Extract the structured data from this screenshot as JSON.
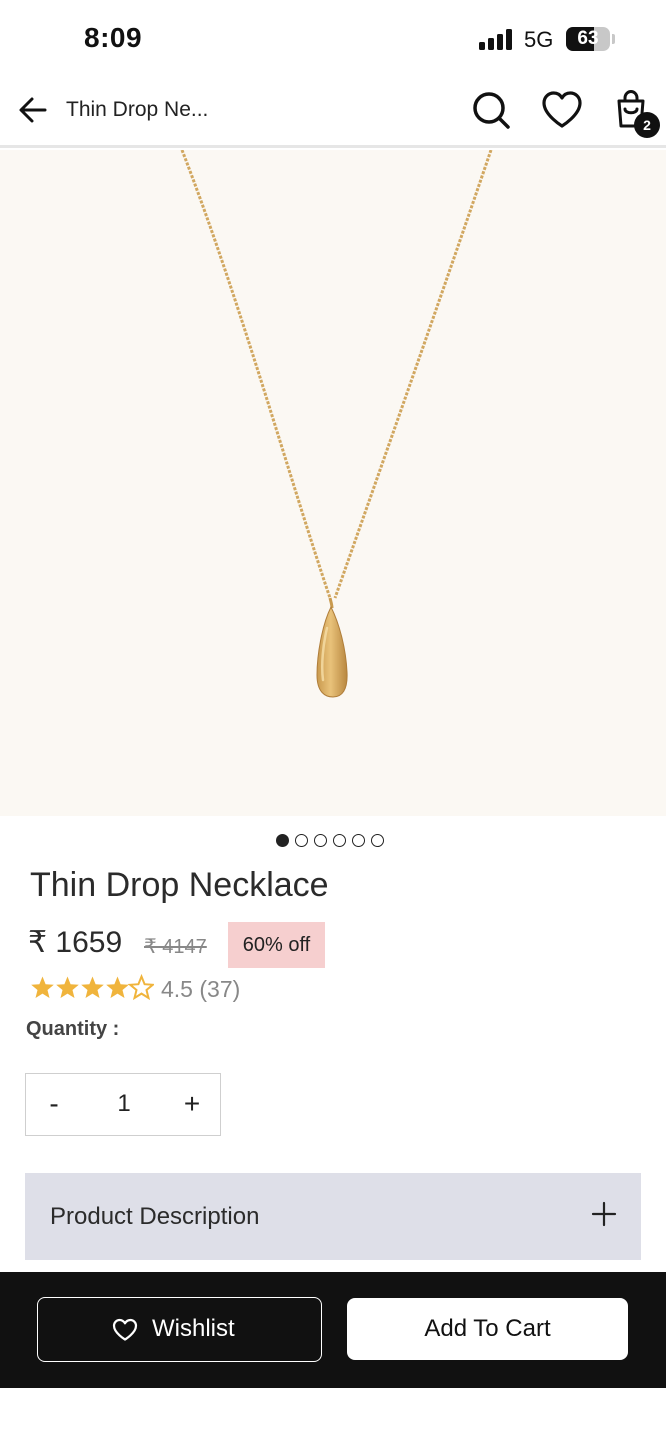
{
  "status_bar": {
    "time": "8:09",
    "network": "5G",
    "battery_percent": "63",
    "battery_level": 0.63
  },
  "header": {
    "title": "Thin Drop Ne...",
    "back_icon": "arrow-left-icon",
    "search_icon": "search-icon",
    "wishlist_icon": "heart-icon",
    "cart_icon": "shopping-bag-icon",
    "cart_count": "2"
  },
  "gallery": {
    "image_description": "gold chain necklace with teardrop pendant",
    "total_images": 6,
    "active_index": 0
  },
  "product": {
    "name": "Thin Drop Necklace",
    "price": "₹ 1659",
    "mrp": "₹ 4147",
    "discount": "60% off",
    "rating": 4.5,
    "rating_text": "4.5 (37)",
    "star_color": "#f0b43c"
  },
  "quantity": {
    "label": "Quantity :",
    "decrement": "-",
    "value": "1",
    "increment": "+"
  },
  "description": {
    "label": "Product Description",
    "expand_icon": "plus-icon"
  },
  "actions": {
    "wishlist_label": "Wishlist",
    "add_to_cart_label": "Add To Cart"
  },
  "colors": {
    "discount_bg": "#f6cfcf",
    "description_bg": "#dedfe8",
    "bottom_bar_bg": "#111111",
    "image_bg": "#fbf8f3"
  }
}
